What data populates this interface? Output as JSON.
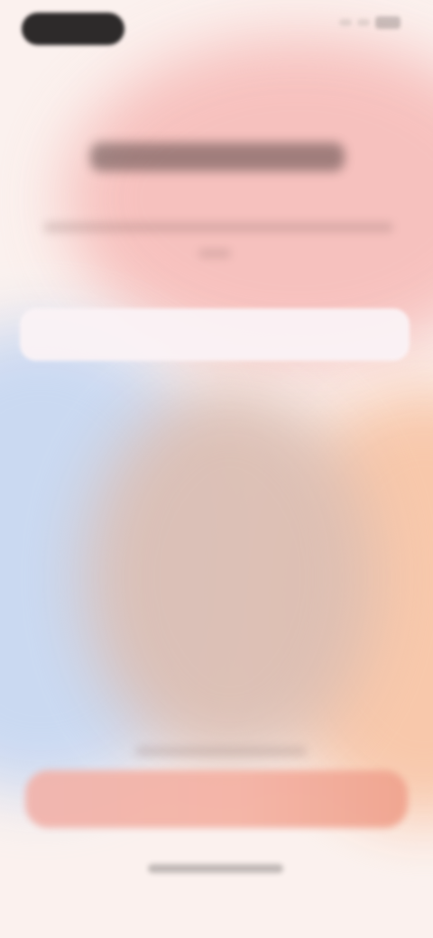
{
  "app": {
    "title": "",
    "subtitle": ""
  },
  "input": {
    "placeholder": "",
    "value": ""
  },
  "cta": {
    "label": ""
  },
  "colors": {
    "background": "#fbf1ee",
    "blob_pink": "#f6b9b6",
    "blob_blue": "#c8d8f2",
    "blob_peach": "#f8c6a8",
    "blob_mauve": "#dcbfb4",
    "cta_gradient_start": "#f1b4ad",
    "cta_gradient_end": "#f0a48f"
  }
}
